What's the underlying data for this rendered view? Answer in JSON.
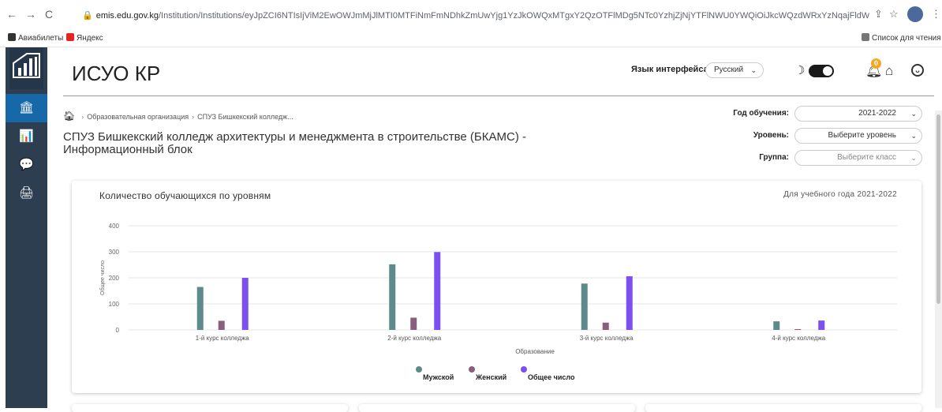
{
  "browser": {
    "url_main": "emis.edu.gov.kg",
    "url_rest": "/Institution/Institutions/eyJpZCI6NTIsIjViM2EwOWJmMjJlMTI0MTFiNmFmNDhkZmUwYjg1YzJkOWQxMTgxY2QzOTFlMDg5NTc0YzhjZjNjYTFlNWU0YWQiOiJkcWQzdWRxYzNqajFldW51YW9xY...",
    "bookmarks": [
      {
        "label": "Авиабилеты"
      },
      {
        "label": "Яндекс"
      }
    ],
    "reading_list": "Список для чтения"
  },
  "sidebar": {
    "items": [
      {
        "icon": "institution-icon",
        "glyph": "🏛"
      },
      {
        "icon": "bar-chart-icon",
        "glyph": "📊"
      },
      {
        "icon": "chat-icon",
        "glyph": "💬"
      },
      {
        "icon": "print-icon",
        "glyph": "🖨"
      }
    ]
  },
  "header": {
    "app_title": "ИСУО КР",
    "lang_label": "Язык интерфейса:",
    "lang_value": "Русский",
    "notification_count": "0"
  },
  "breadcrumb": {
    "items": [
      "Образовательная организация",
      "СПУЗ Бишкекский колледж..."
    ]
  },
  "org_title": "СПУЗ Бишкекский колледж архитектуры и менеджмента в строительстве (БКАМС) - Информационный блок",
  "filters": {
    "year_label": "Год обучения:",
    "year_value": "2021-2022",
    "level_label": "Уровень:",
    "level_value": "Выберите уровень",
    "group_label": "Группа:",
    "group_placeholder": "Выберите класс"
  },
  "card": {
    "title": "Количество обучающихся по уровням",
    "subtitle": "Для учебного года 2021-2022"
  },
  "colors": {
    "male": "#5f8a8b",
    "female": "#8a5f7e",
    "total": "#7b4ff0"
  },
  "chart_data": {
    "type": "bar",
    "categories": [
      "1-й курс колледжа",
      "2-й курс колледжа",
      "3-й курс колледжа",
      "4-й курс колледжа"
    ],
    "series": [
      {
        "name": "Мужской",
        "values": [
          165,
          252,
          178,
          33
        ]
      },
      {
        "name": "Женский",
        "values": [
          35,
          47,
          28,
          3
        ]
      },
      {
        "name": "Общее число",
        "values": [
          200,
          299,
          206,
          36
        ]
      }
    ],
    "xlabel": "Образование",
    "ylabel": "Общее число",
    "ylim": [
      0,
      400
    ],
    "yticks": [
      0,
      100,
      200,
      300,
      400
    ],
    "grid": true,
    "legend": "bottom"
  }
}
